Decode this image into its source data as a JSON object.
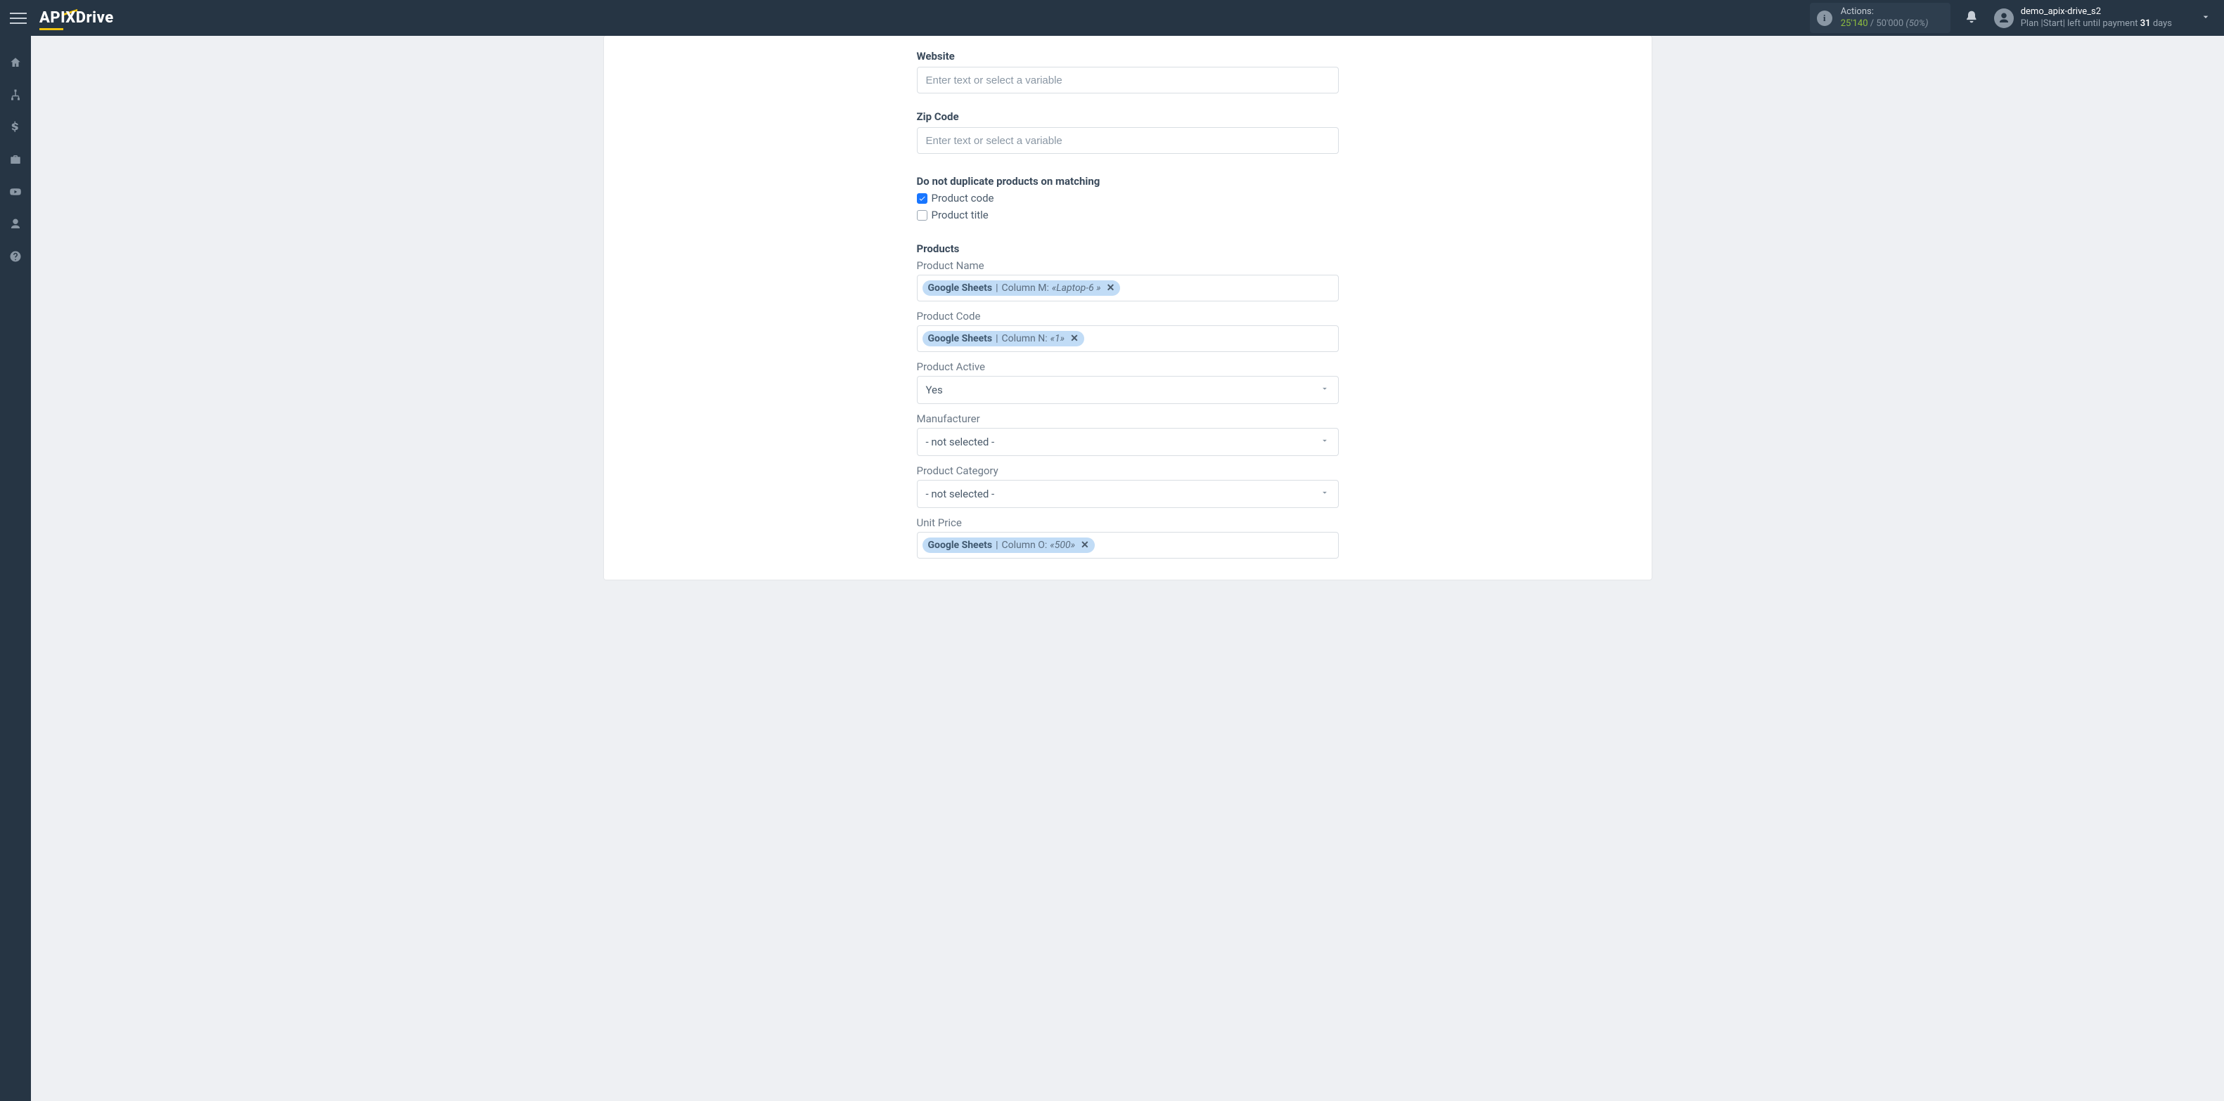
{
  "topbar": {
    "logo": {
      "brand_left": "API",
      "brand_x": "X",
      "brand_right": "Drive"
    },
    "actions": {
      "label": "Actions:",
      "used": "25'140",
      "total": "50'000",
      "percent": "(50%)"
    },
    "account": {
      "name": "demo_apix-drive_s2",
      "plan_label": "Plan ",
      "plan_value": "|Start|",
      "payment_prefix": " left until payment ",
      "payment_days": "31",
      "payment_suffix": " days"
    }
  },
  "sidebar": {
    "items": [
      {
        "name": "home-icon"
      },
      {
        "name": "sitemap-icon"
      },
      {
        "name": "dollar-icon"
      },
      {
        "name": "briefcase-icon"
      },
      {
        "name": "youtube-icon"
      },
      {
        "name": "user-icon"
      },
      {
        "name": "help-icon"
      }
    ]
  },
  "form": {
    "website_label": "Website",
    "website_placeholder": "Enter text or select a variable",
    "zip_label": "Zip Code",
    "zip_placeholder": "Enter text or select a variable",
    "nodup": {
      "heading": "Do not duplicate products on matching",
      "product_code": {
        "label": "Product code",
        "checked": true
      },
      "product_title": {
        "label": "Product title",
        "checked": false
      }
    },
    "products": {
      "heading": "Products",
      "name": {
        "label": "Product Name",
        "token": {
          "source": "Google Sheets",
          "column": "Column M:",
          "value": "«Laptop-6 »"
        }
      },
      "code": {
        "label": "Product Code",
        "token": {
          "source": "Google Sheets",
          "column": "Column N:",
          "value": "«1»"
        }
      },
      "active": {
        "label": "Product Active",
        "value": "Yes"
      },
      "manufacturer": {
        "label": "Manufacturer",
        "value": "- not selected -"
      },
      "category": {
        "label": "Product Category",
        "value": "- not selected -"
      },
      "unit_price": {
        "label": "Unit Price",
        "token": {
          "source": "Google Sheets",
          "column": "Column O:",
          "value": "«500»"
        }
      }
    }
  }
}
